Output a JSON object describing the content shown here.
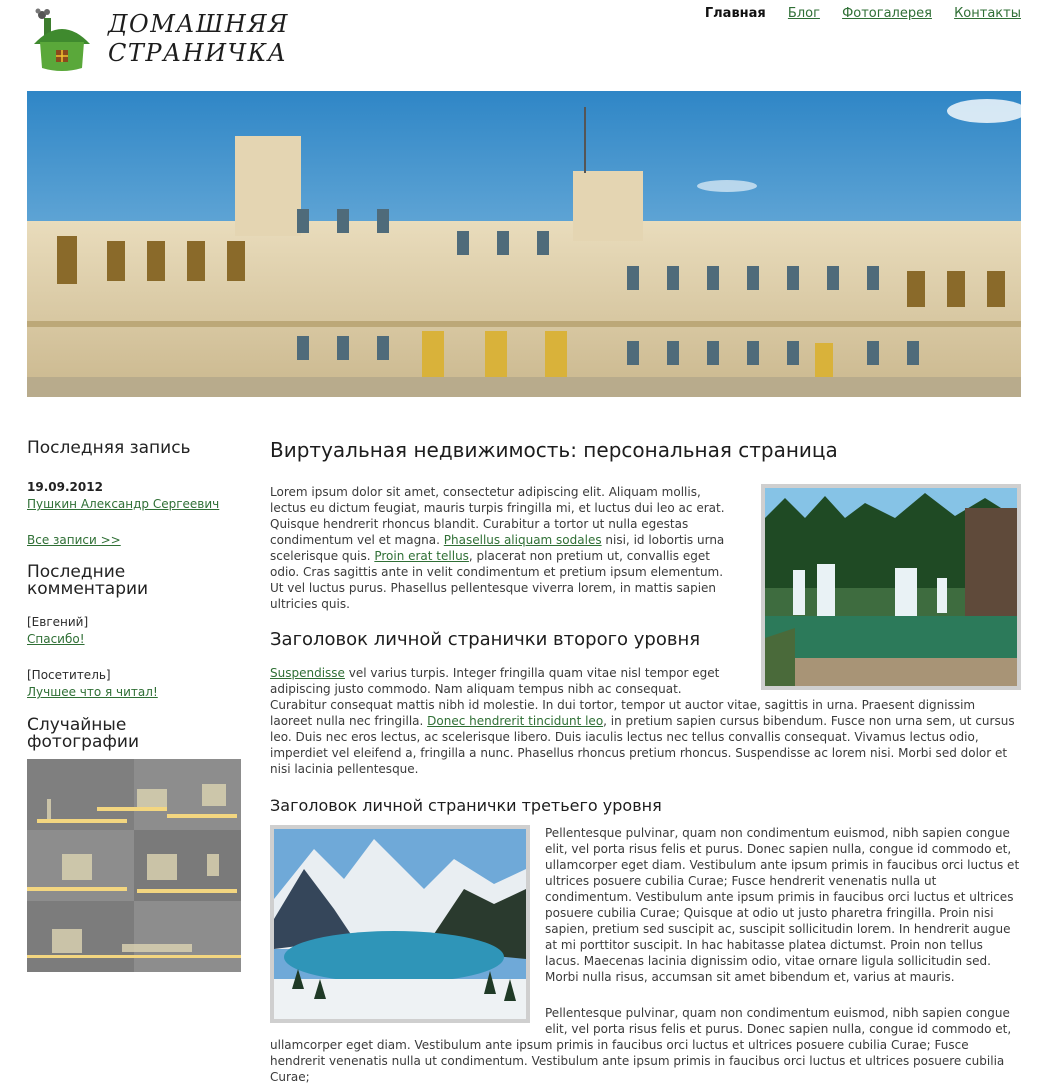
{
  "header": {
    "site_title_line1": "Домашняя",
    "site_title_line2": "страничка",
    "logo_icon": "house-icon"
  },
  "nav": [
    {
      "label": "Главная",
      "active": true
    },
    {
      "label": "Блог",
      "active": false
    },
    {
      "label": "Фотогалерея",
      "active": false
    },
    {
      "label": "Контакты",
      "active": false
    }
  ],
  "banner": {
    "image": "palace-photo"
  },
  "sidebar": {
    "latest_post": {
      "heading": "Последняя запись",
      "date": "19.09.2012",
      "author": "Пушкин Александр Сергеевич",
      "all_posts": "Все записи >>"
    },
    "latest_comments": {
      "heading": "Последние комментарии",
      "items": [
        {
          "author": "[Евгений]",
          "text": "Спасибо!"
        },
        {
          "author": "[Посетитель]",
          "text": "Лучшее что я читал!"
        }
      ]
    },
    "random_photos": {
      "heading": "Случайные фотографии"
    }
  },
  "content": {
    "title": "Виртуальная недвижимость: персональная страница",
    "p1": {
      "text_a": "Lorem ipsum dolor sit amet, consectetur adipiscing elit. Aliquam mollis, lectus eu dictum feugiat, mauris turpis fringilla mi, et luctus dui leo ac erat. Quisque hendrerit rhoncus blandit. Curabitur a tortor ut nulla egestas condimentum vel et magna. ",
      "link_a": "Phasellus aliquam sodales",
      "text_b": " nisi, id lobortis urna scelerisque quis. ",
      "link_b": "Proin erat tellus",
      "text_c": ", placerat non pretium ut, convallis eget odio. Cras sagittis ante in velit condimentum et pretium ipsum elementum. Ut vel luctus purus. Phasellus pellentesque viverra lorem, in mattis sapien ultricies quis."
    },
    "h2": "Заголовок личной странички второго уровня",
    "p2": {
      "link_a": "Suspendisse",
      "text_a": " vel varius turpis. Integer fringilla quam vitae nisl tempor eget adipiscing justo commodo. Nam aliquam tempus nibh ac consequat. Curabitur consequat mattis nibh id molestie. In dui tortor, tempor ut auctor vitae, sagittis in urna. Praesent dignissim laoreet nulla nec fringilla. ",
      "link_b": "Donec hendrerit tincidunt leo",
      "text_b": ", in pretium sapien cursus bibendum. Fusce non urna sem, ut cursus leo. Duis nec eros lectus, ac scelerisque libero. Duis iaculis lectus nec tellus convallis consequat. Vivamus lectus odio, imperdiet vel eleifend a, fringilla a nunc. Phasellus rhoncus pretium rhoncus. Suspendisse ac lorem nisi. Morbi sed dolor et nisi lacinia pellentesque."
    },
    "h3": "Заголовок личной странички третьего уровня",
    "p3": "Pellentesque pulvinar, quam non condimentum euismod, nibh sapien congue elit, vel porta risus felis et purus. Donec sapien nulla, congue id commodo et, ullamcorper eget diam. Vestibulum ante ipsum primis in faucibus orci luctus et ultrices posuere cubilia Curae; Fusce hendrerit venenatis nulla ut condimentum. Vestibulum ante ipsum primis in faucibus orci luctus et ultrices posuere cubilia Curae; Quisque at odio ut justo pharetra fringilla. Proin nisi sapien, pretium sed suscipit ac, suscipit sollicitudin lorem. In hendrerit augue at mi porttitor suscipit. In hac habitasse platea dictumst. Proin non tellus lacus. Maecenas lacinia dignissim odio, vitae ornare ligula sollicitudin sed. Morbi nulla risus, accumsan sit amet bibendum et, varius at mauris.",
    "p4": "Pellentesque pulvinar, quam non condimentum euismod, nibh sapien congue elit, vel porta risus felis et purus. Donec sapien nulla, congue id commodo et, ullamcorper eget diam. Vestibulum ante ipsum primis in faucibus orci luctus et ultrices posuere cubilia Curae; Fusce hendrerit venenatis nulla ut condimentum. Vestibulum ante ipsum primis in faucibus orci luctus et ultrices posuere cubilia Curae;"
  },
  "colors": {
    "link": "#2f6f35",
    "text": "#3a3a3a",
    "heading": "#1d1d1d",
    "image_border": "#cfcfcf"
  }
}
